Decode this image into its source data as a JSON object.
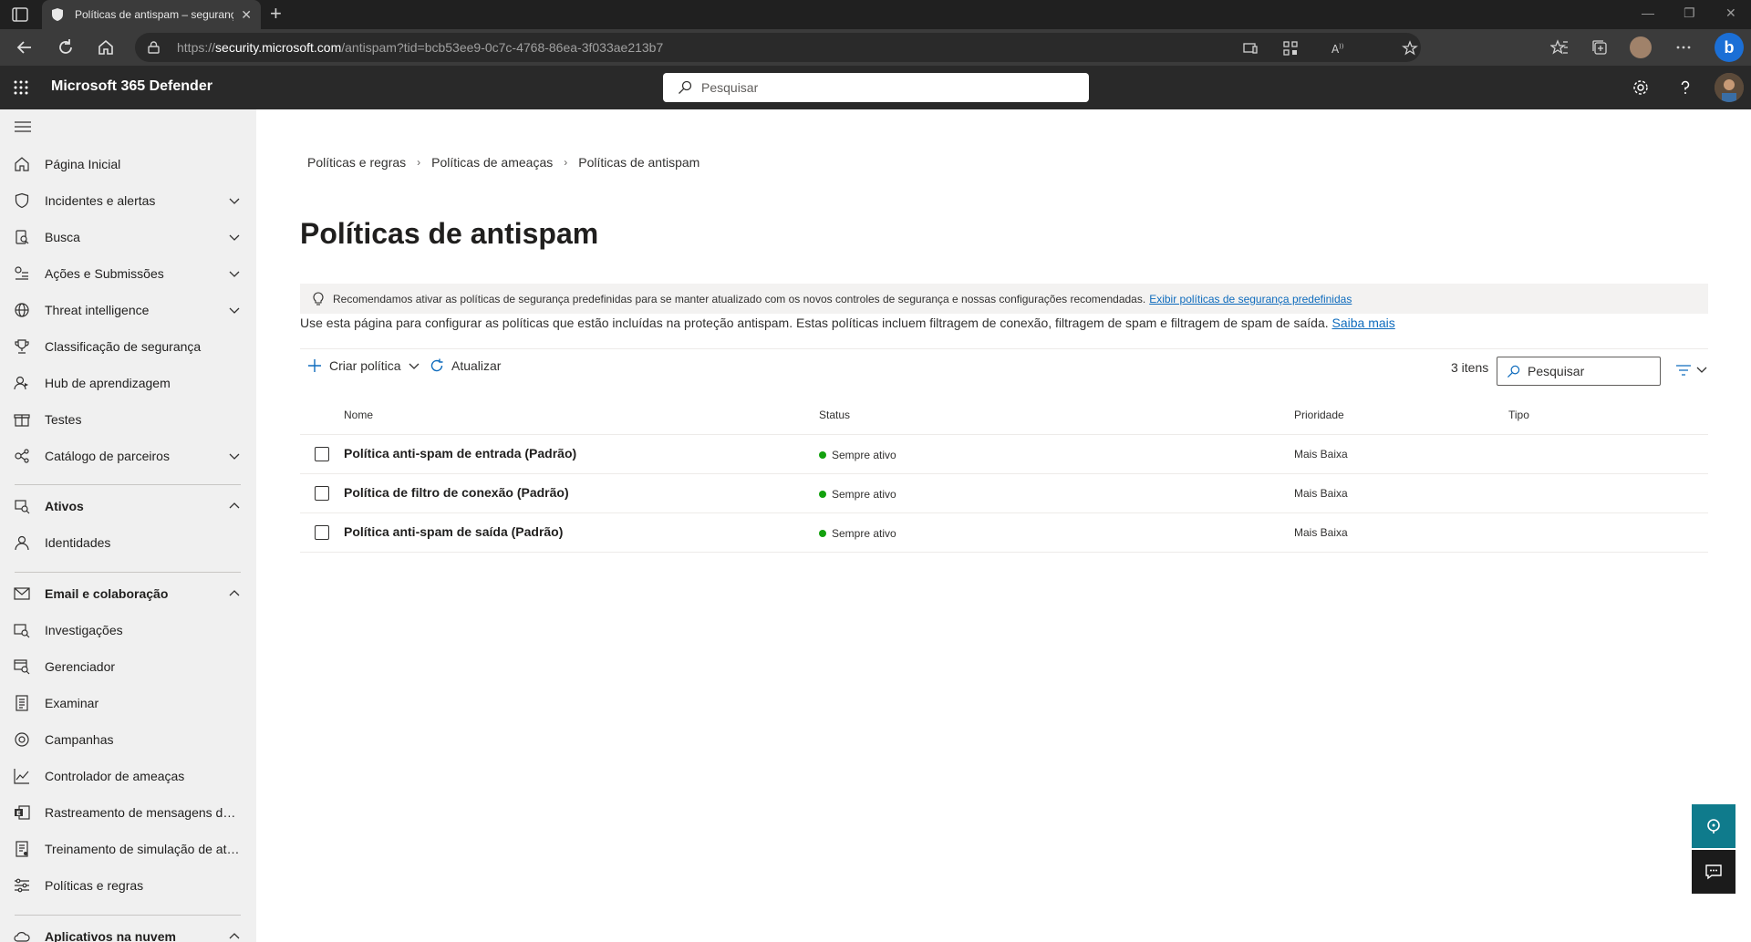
{
  "browser": {
    "tab_title": "Políticas de antispam – segurança",
    "url_scheme": "https://",
    "url_host": "security.microsoft.com",
    "url_path": "/antispam?tid=bcb53ee9-0c7c-4768-86ea-3f033ae213b7"
  },
  "app": {
    "title": "Microsoft 365 Defender",
    "search_placeholder": "Pesquisar"
  },
  "sidebar": {
    "items": [
      {
        "label": "Página Inicial"
      },
      {
        "label": "Incidentes e alertas"
      },
      {
        "label": "Busca"
      },
      {
        "label": "Ações e Submissões"
      },
      {
        "label": "Threat intelligence"
      },
      {
        "label": "Classificação de segurança"
      },
      {
        "label": "Hub de aprendizagem"
      },
      {
        "label": "Testes"
      },
      {
        "label": "Catálogo de parceiros"
      },
      {
        "label": "Ativos"
      },
      {
        "label": "Identidades"
      },
      {
        "label": "Email e colaboração"
      },
      {
        "label": "Investigações"
      },
      {
        "label": "Gerenciador"
      },
      {
        "label": "Examinar"
      },
      {
        "label": "Campanhas"
      },
      {
        "label": "Controlador de ameaças"
      },
      {
        "label": "Rastreamento de mensagens do ..."
      },
      {
        "label": "Treinamento de simulação de ata..."
      },
      {
        "label": "Políticas e regras"
      },
      {
        "label": "Aplicativos na nuvem"
      }
    ]
  },
  "breadcrumb": [
    "Políticas e regras",
    "Políticas de ameaças",
    "Políticas de antispam"
  ],
  "page": {
    "title": "Políticas de antispam",
    "banner_text": "Recomendamos ativar as políticas de segurança predefinidas para se manter atualizado com os novos controles de segurança e nossas configurações recomendadas.",
    "banner_link": "Exibir políticas de segurança predefinidas",
    "description": "Use esta página para configurar as políticas que estão incluídas na proteção antispam. Estas políticas incluem filtragem de conexão, filtragem de spam e filtragem de spam de saída.",
    "description_link": "Saiba mais"
  },
  "toolbar": {
    "create_label": "Criar política",
    "refresh_label": "Atualizar",
    "count_label": "3 itens",
    "search_placeholder": "Pesquisar"
  },
  "table": {
    "headers": [
      "Nome",
      "Status",
      "Prioridade",
      "Tipo"
    ],
    "rows": [
      {
        "name": "Política anti-spam de entrada (Padrão)",
        "status": "Sempre ativo",
        "priority": "Mais Baixa",
        "type": ""
      },
      {
        "name": "Política de filtro de conexão (Padrão)",
        "status": "Sempre ativo",
        "priority": "Mais Baixa",
        "type": ""
      },
      {
        "name": "Política anti-spam de saída (Padrão)",
        "status": "Sempre ativo",
        "priority": "Mais Baixa",
        "type": ""
      }
    ]
  },
  "colors": {
    "header_bg": "#292929",
    "sidebar_bg": "#f0f0f0",
    "link": "#0f6cbd",
    "status_active": "#13a10e",
    "float_accent": "#0f7b8c"
  }
}
